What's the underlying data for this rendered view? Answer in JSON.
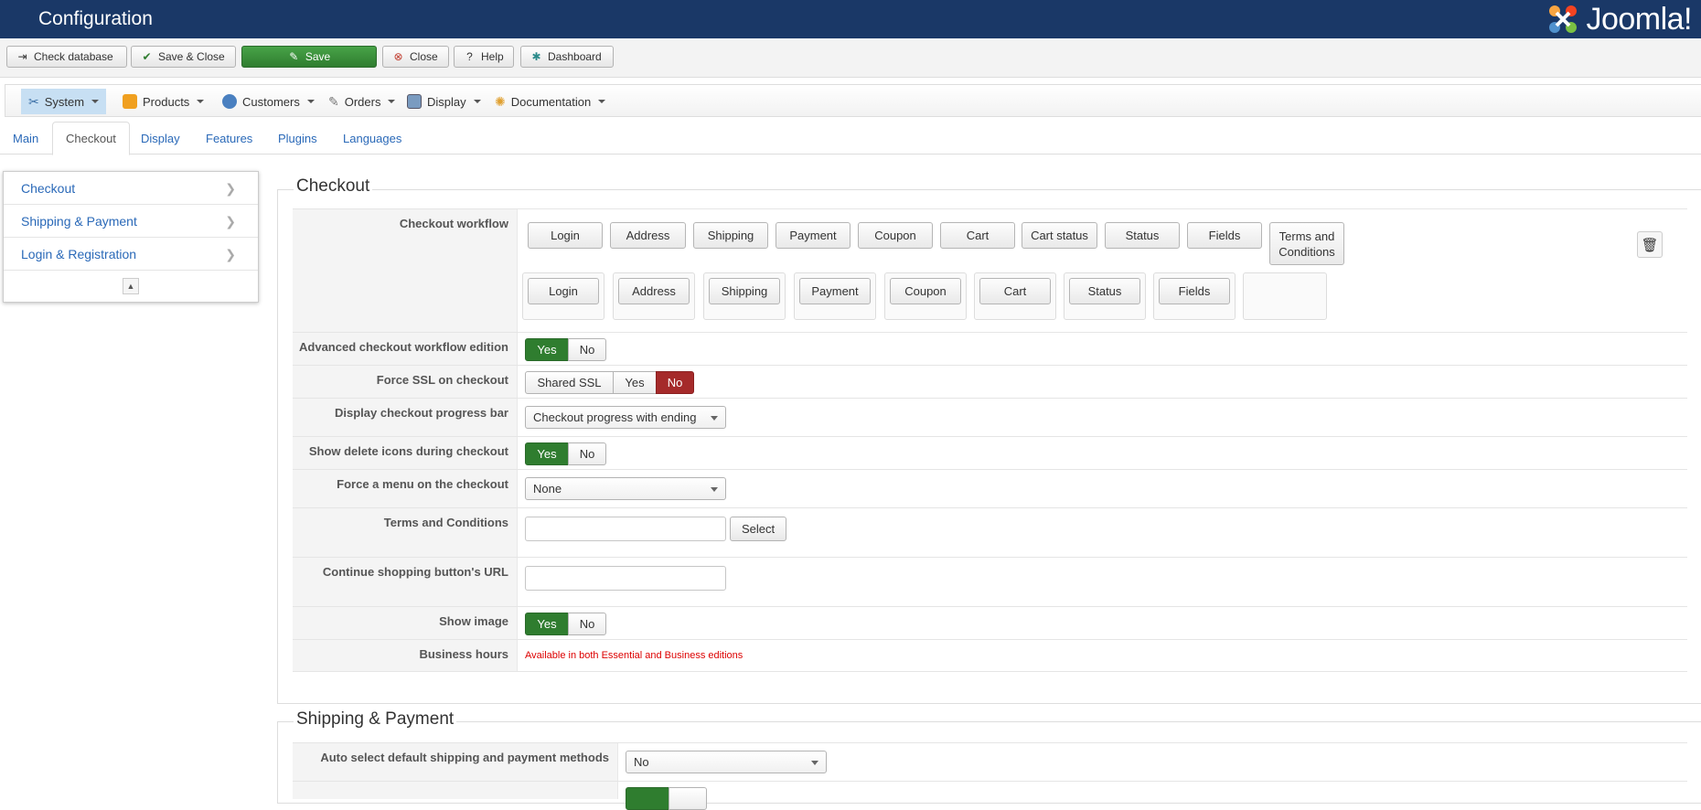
{
  "header": {
    "title": "Configuration",
    "logo_text": "Joomla!"
  },
  "toolbar": {
    "check_database": "Check database",
    "save_close": "Save & Close",
    "save": "Save",
    "close": "Close",
    "help": "Help",
    "dashboard": "Dashboard"
  },
  "menu": {
    "items": [
      {
        "label": "System",
        "icon": "tools-icon"
      },
      {
        "label": "Products",
        "icon": "box-icon"
      },
      {
        "label": "Customers",
        "icon": "users-icon"
      },
      {
        "label": "Orders",
        "icon": "cart-icon"
      },
      {
        "label": "Display",
        "icon": "monitor-icon"
      },
      {
        "label": "Documentation",
        "icon": "gear-icon"
      }
    ]
  },
  "tabs": [
    "Main",
    "Checkout",
    "Display",
    "Features",
    "Plugins",
    "Languages"
  ],
  "sidenav": [
    "Checkout",
    "Shipping & Payment",
    "Login & Registration"
  ],
  "checkout": {
    "legend": "Checkout",
    "workflow_label": "Checkout workflow",
    "workflow_row1": [
      "Login",
      "Address",
      "Shipping",
      "Payment",
      "Coupon",
      "Cart",
      "Cart status",
      "Status",
      "Fields",
      "Terms and Conditions"
    ],
    "workflow_row2": [
      "Login",
      "Address",
      "Shipping",
      "Payment",
      "Coupon",
      "Cart",
      "Status",
      "Fields"
    ],
    "advanced_label": "Advanced checkout workflow edition",
    "yes": "Yes",
    "no": "No",
    "ssl_label": "Force SSL on checkout",
    "shared_ssl": "Shared SSL",
    "progress_label": "Display checkout progress bar",
    "progress_value": "Checkout progress with ending",
    "delete_icons_label": "Show delete icons during checkout",
    "menu_label": "Force a menu on the checkout",
    "menu_value": "None",
    "terms_label": "Terms and Conditions",
    "terms_select": "Select",
    "continue_label": "Continue shopping button's URL",
    "show_image_label": "Show image",
    "business_hours_label": "Business hours",
    "business_hours_notice": "Available in both Essential and Business editions"
  },
  "shipping": {
    "legend": "Shipping & Payment",
    "auto_select_label": "Auto select default shipping and payment methods",
    "auto_select_value": "No"
  },
  "colors": {
    "header": "#1a3867",
    "save_green": "#2f7d2f",
    "no_red": "#a52a2a",
    "link": "#2a69b8"
  }
}
